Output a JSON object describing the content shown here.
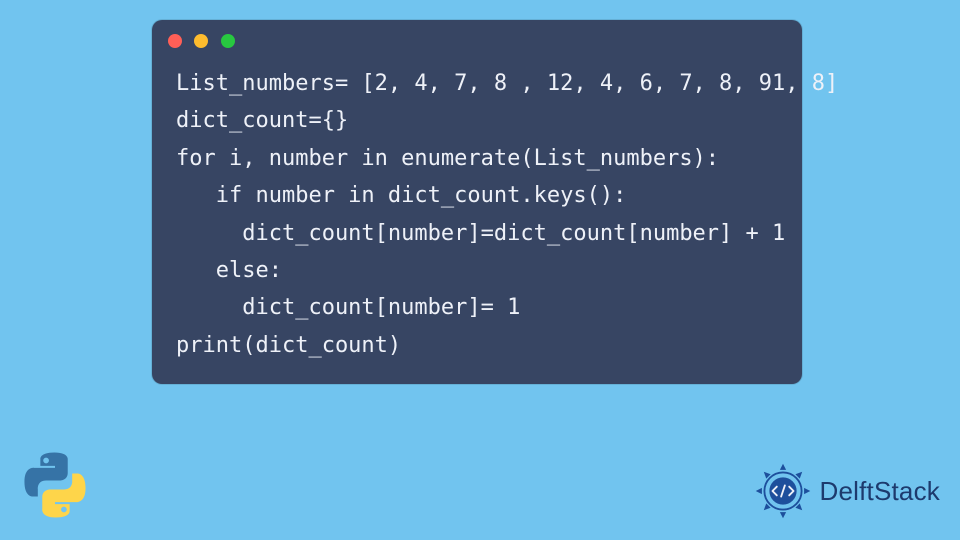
{
  "code": {
    "lines": [
      "List_numbers= [2, 4, 7, 8 , 12, 4, 6, 7, 8, 91, 8]",
      "dict_count={}",
      "for i, number in enumerate(List_numbers):",
      "   if number in dict_count.keys():",
      "     dict_count[number]=dict_count[number] + 1",
      "   else:",
      "     dict_count[number]= 1",
      "print(dict_count)"
    ]
  },
  "brand": {
    "name": "DelftStack"
  },
  "colors": {
    "bg": "#71c4ef",
    "window": "#374563",
    "text": "#eef1f8",
    "dot_red": "#ff5f57",
    "dot_yellow": "#febc2e",
    "dot_green": "#28c840",
    "brand_text": "#1d3a6d"
  }
}
